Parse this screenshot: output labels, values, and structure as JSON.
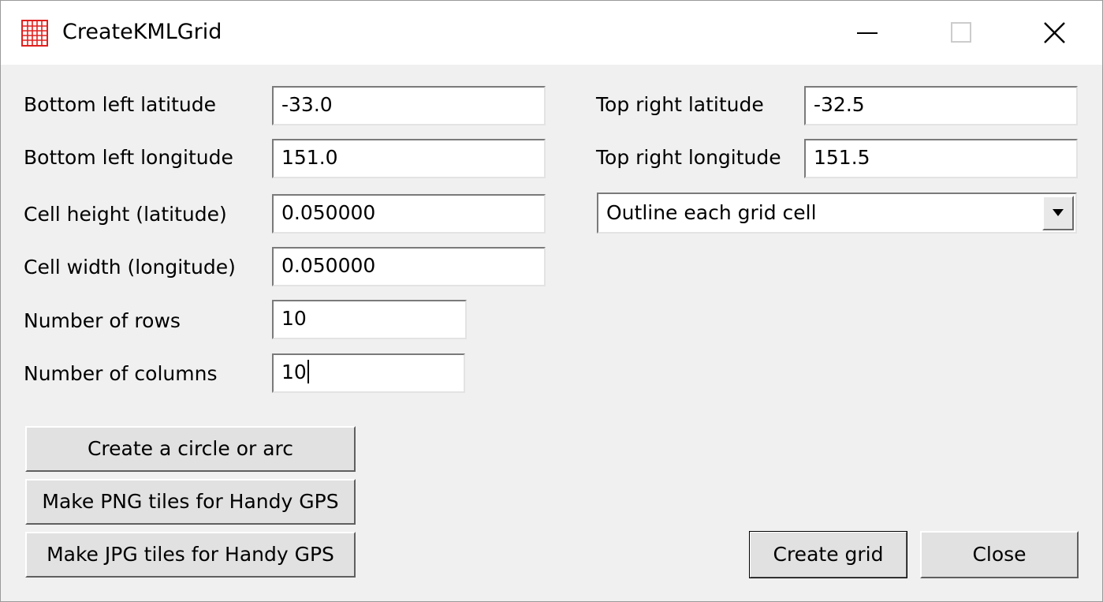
{
  "window": {
    "title": "CreateKMLGrid"
  },
  "left_fields": [
    {
      "label": "Bottom left latitude",
      "value": "-33.0"
    },
    {
      "label": "Bottom left longitude",
      "value": "151.0"
    },
    {
      "label": "Cell height (latitude)",
      "value": "0.050000"
    },
    {
      "label": "Cell width (longitude)",
      "value": "0.050000"
    },
    {
      "label": "Number of rows",
      "value": "10"
    },
    {
      "label": "Number of columns",
      "value": "10"
    }
  ],
  "right_fields": [
    {
      "label": "Top right latitude",
      "value": "-32.5"
    },
    {
      "label": "Top right longitude",
      "value": "151.5"
    }
  ],
  "grid_style": {
    "selected": "Outline each grid cell"
  },
  "buttons": {
    "circle_arc": "Create a circle or arc",
    "png_tiles": "Make PNG tiles for Handy GPS",
    "jpg_tiles": "Make JPG tiles for Handy GPS",
    "create_grid": "Create grid",
    "close": "Close"
  },
  "icons": {
    "app": "grid-icon",
    "minimize": "minimize-icon",
    "maximize": "maximize-icon",
    "close": "close-icon",
    "dropdown": "chevron-down-icon"
  },
  "colors": {
    "app_icon": "#e0201e",
    "window_background": "#f0f0f0"
  }
}
